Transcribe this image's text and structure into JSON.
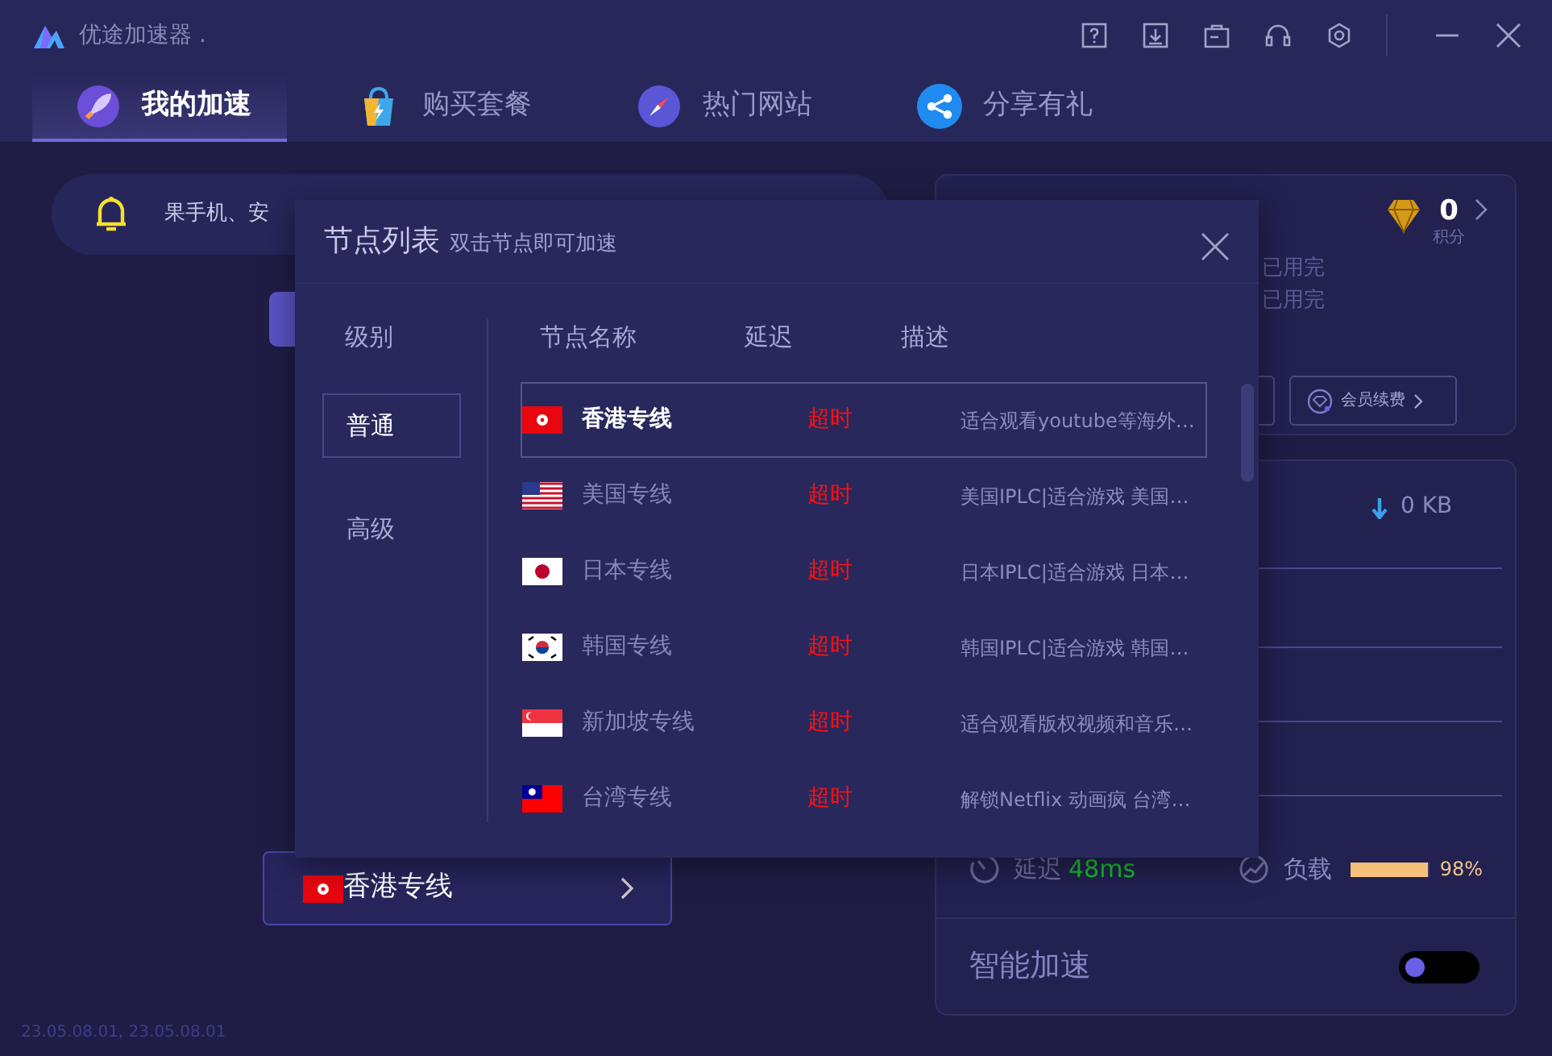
{
  "window": {
    "title": "优途加速器 ."
  },
  "tabs": [
    {
      "label": "我的加速",
      "selected": true
    },
    {
      "label": "购买套餐",
      "selected": false
    },
    {
      "label": "热门网站",
      "selected": false
    },
    {
      "label": "分享有礼",
      "selected": false
    }
  ],
  "notice": {
    "text": "果手机、安"
  },
  "account": {
    "points": "0",
    "points_label": "积分",
    "quota_lines": [
      "已用完",
      "已用完"
    ],
    "renew_button": "会员续费"
  },
  "traffic": {
    "download": "0 KB"
  },
  "stats": {
    "latency_label": "延迟",
    "latency": "48ms",
    "load_label": "负载",
    "load": {
      "level": 0.98
    },
    "load_reading": "98%"
  },
  "smart": {
    "label": "智能加速",
    "on": false
  },
  "current_node": {
    "name": "香港专线"
  },
  "version": "23.05.08.01, 23.05.08.01",
  "dialog": {
    "title": "节点列表",
    "subtitle": "双击节点即可加速",
    "levels_heading": "级别",
    "levels": [
      {
        "label": "普通",
        "selected": true
      },
      {
        "label": "高级",
        "selected": false
      }
    ],
    "columns": [
      "节点名称",
      "延迟",
      "描述"
    ],
    "nodes": [
      {
        "name": "香港专线",
        "latency": "超时",
        "description": "适合观看youtube等海外…",
        "selected": true
      },
      {
        "name": "美国专线",
        "latency": "超时",
        "description": "美国IPLC|适合游戏 美国…",
        "selected": false
      },
      {
        "name": "日本专线",
        "latency": "超时",
        "description": "日本IPLC|适合游戏 日本…",
        "selected": false
      },
      {
        "name": "韩国专线",
        "latency": "超时",
        "description": "韩国IPLC|适合游戏 韩国…",
        "selected": false
      },
      {
        "name": "新加坡专线",
        "latency": "超时",
        "description": "适合观看版权视频和音乐…",
        "selected": false
      },
      {
        "name": "台湾专线",
        "latency": "超时",
        "description": "解锁Netflix 动画疯 台湾…",
        "selected": false
      }
    ]
  }
}
